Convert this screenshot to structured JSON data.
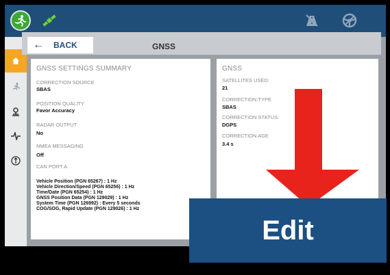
{
  "header": {
    "back_label": "BACK",
    "title": "GNSS"
  },
  "summary": {
    "title": "GNSS SETTINGS SUMMARY",
    "correction_source_label": "CORRECTION SOURCE",
    "correction_source_value": "SBAS",
    "position_quality_label": "POSITION QUALITY",
    "position_quality_value": "Favor Accuracy",
    "radar_output_label": "RADAR OUTPUT",
    "radar_output_value": "No",
    "nmea_label": "NMEA MESSAGING",
    "nmea_value": "Off",
    "can_port_label": "CAN PORT A",
    "can_lines": [
      "Vehicle Position (PGN 65267) : 1 Hz",
      "Vehicle Direction/Speed (PGN 65256) : 1 Hz",
      "Time/Date (PGN 65254) : 1 Hz",
      "GNSS Position Data (PGN 129029) : 1 Hz",
      "System Time (PGN 126992) : Every 5 seconds",
      "COG/SOG, Rapid Update (PGN 129026) : 1 Hz"
    ]
  },
  "gnss": {
    "title": "GNSS",
    "satellites_label": "SATELLITES USED:",
    "satellites_value": "21",
    "correction_type_label": "CORRECTION TYPE",
    "correction_type_value": "SBAS",
    "correction_status_label": "CORRECTION STATUS:",
    "correction_status_value": "DGPS",
    "correction_age_label": "CORRECTION AGE",
    "correction_age_value": "3.4 s"
  },
  "callout": {
    "label": "Edit",
    "arrow_color": "#e8231b",
    "box_color": "#1c4f82"
  },
  "colors": {
    "topbar": "#1f4e78",
    "status_green": "#3aa935",
    "active_tab": "#f5a623"
  },
  "icons": {
    "status": "run-icon",
    "gnss": "satellite-icon",
    "top_right": [
      "no-guidance-icon",
      "steering-wheel-icon"
    ],
    "sidebar": [
      "home-icon",
      "guidance-icon",
      "receiver-icon",
      "signal-icon",
      "steering-icon"
    ]
  }
}
